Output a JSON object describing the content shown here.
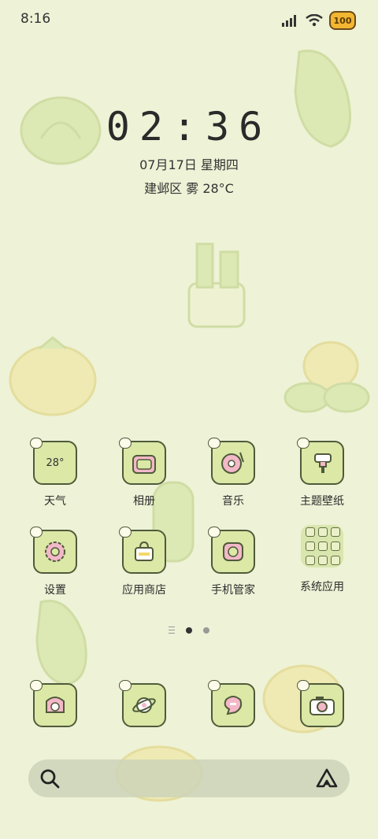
{
  "status_bar": {
    "time": "8:16",
    "battery": "100"
  },
  "clock": {
    "time": "02:36",
    "date": "07月17日 星期四",
    "weather": "建邺区 雾 28°C"
  },
  "apps_row1": [
    {
      "label": "天气",
      "icon": "weather-icon",
      "badge": "28°"
    },
    {
      "label": "相册",
      "icon": "gallery-icon"
    },
    {
      "label": "音乐",
      "icon": "music-icon"
    },
    {
      "label": "主题壁纸",
      "icon": "theme-icon"
    }
  ],
  "apps_row2": [
    {
      "label": "设置",
      "icon": "settings-icon"
    },
    {
      "label": "应用商店",
      "icon": "app-store-icon"
    },
    {
      "label": "手机管家",
      "icon": "phone-manager-icon"
    },
    {
      "label": "系统应用",
      "icon": "folder-icon"
    }
  ],
  "dock": [
    {
      "icon": "phone-icon"
    },
    {
      "icon": "browser-icon"
    },
    {
      "icon": "messages-icon"
    },
    {
      "icon": "camera-icon"
    }
  ],
  "colors": {
    "background": "#eef2d6",
    "icon_fill": "#dbe8a6",
    "icon_border": "#4f5a3a",
    "battery": "#f2b632"
  }
}
